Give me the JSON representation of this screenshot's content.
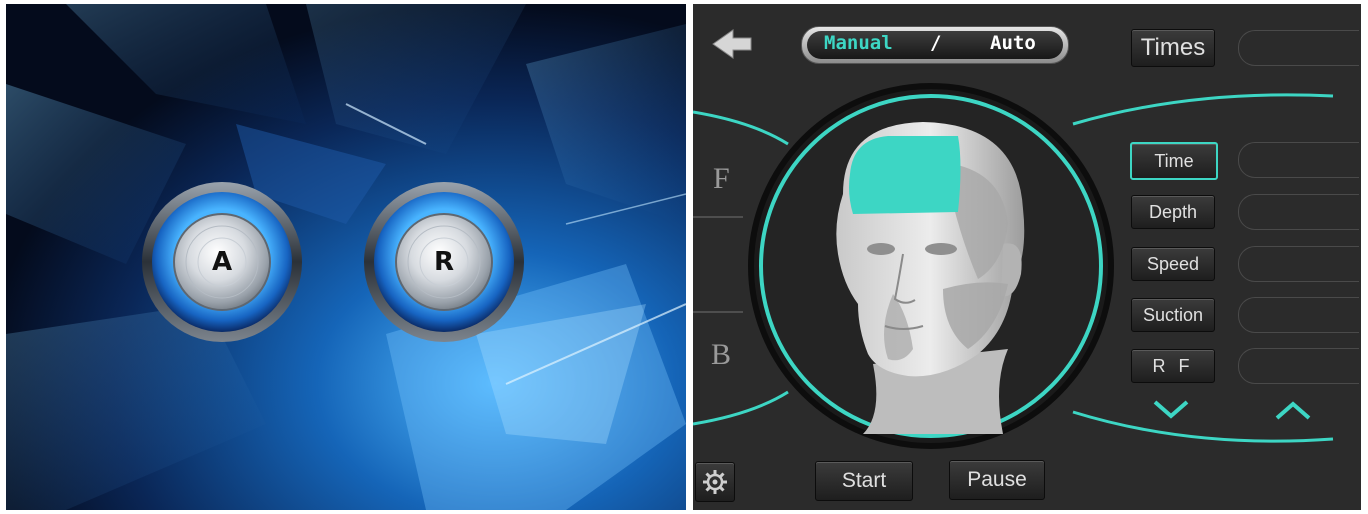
{
  "left_panel": {
    "buttons": [
      {
        "label": "A"
      },
      {
        "label": "R"
      }
    ]
  },
  "right_panel": {
    "mode": {
      "manual": "Manual",
      "separator": "/",
      "auto": "Auto",
      "selected": "Manual"
    },
    "times_label": "Times",
    "side_labels": {
      "front": "F",
      "back": "B"
    },
    "params": [
      {
        "label": "Time",
        "active": true
      },
      {
        "label": "Depth",
        "active": false
      },
      {
        "label": "Speed",
        "active": false
      },
      {
        "label": "Suction",
        "active": false
      },
      {
        "label": "R F",
        "active": false
      }
    ],
    "start_label": "Start",
    "pause_label": "Pause"
  },
  "colors": {
    "accent": "#3dd6c4",
    "panel_bg": "#2b2b2b",
    "left_bg": "#06122a"
  }
}
